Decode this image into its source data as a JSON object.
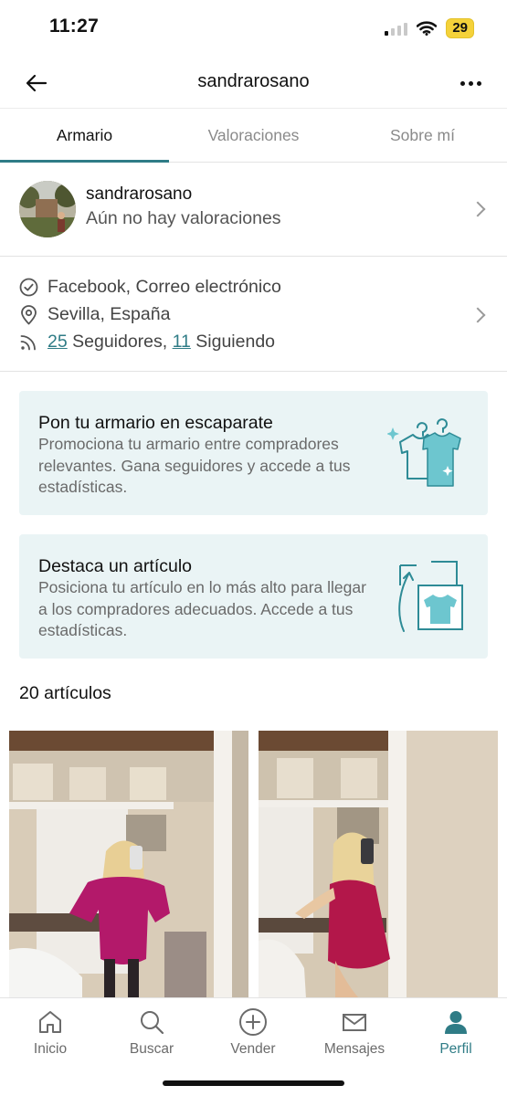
{
  "status": {
    "time": "11:27",
    "battery": "29"
  },
  "header": {
    "title": "sandrarosano"
  },
  "tabs": [
    {
      "label": "Armario",
      "active": true
    },
    {
      "label": "Valoraciones",
      "active": false
    },
    {
      "label": "Sobre mí",
      "active": false
    }
  ],
  "profile": {
    "username": "sandrarosano",
    "rating_text": "Aún no hay valoraciones"
  },
  "info": {
    "verified": "Facebook, Correo electrónico",
    "location": "Sevilla, España",
    "followers_count": "25",
    "followers_label": " Seguidores, ",
    "following_count": "11",
    "following_label": " Siguiendo"
  },
  "promos": [
    {
      "title": "Pon tu armario en escaparate",
      "description": "Promociona tu armario entre compradores relevantes. Gana seguidores y accede a tus estadísticas.",
      "icon": "closet-spotlight-icon"
    },
    {
      "title": "Destaca un artículo",
      "description": "Posiciona tu artículo en lo más alto para llegar a los compradores adecuados. Accede a tus estadísticas.",
      "icon": "item-bump-icon"
    }
  ],
  "items_count": "20 artículos",
  "bottom_nav": [
    {
      "label": "Inicio",
      "icon": "home-icon",
      "active": false
    },
    {
      "label": "Buscar",
      "icon": "search-icon",
      "active": false
    },
    {
      "label": "Vender",
      "icon": "plus-circle-icon",
      "active": false
    },
    {
      "label": "Mensajes",
      "icon": "mail-icon",
      "active": false
    },
    {
      "label": "Perfil",
      "icon": "profile-icon",
      "active": true
    }
  ],
  "colors": {
    "accent": "#2f7c86",
    "card_bg": "#eaf4f5",
    "battery": "#f5d23a"
  }
}
